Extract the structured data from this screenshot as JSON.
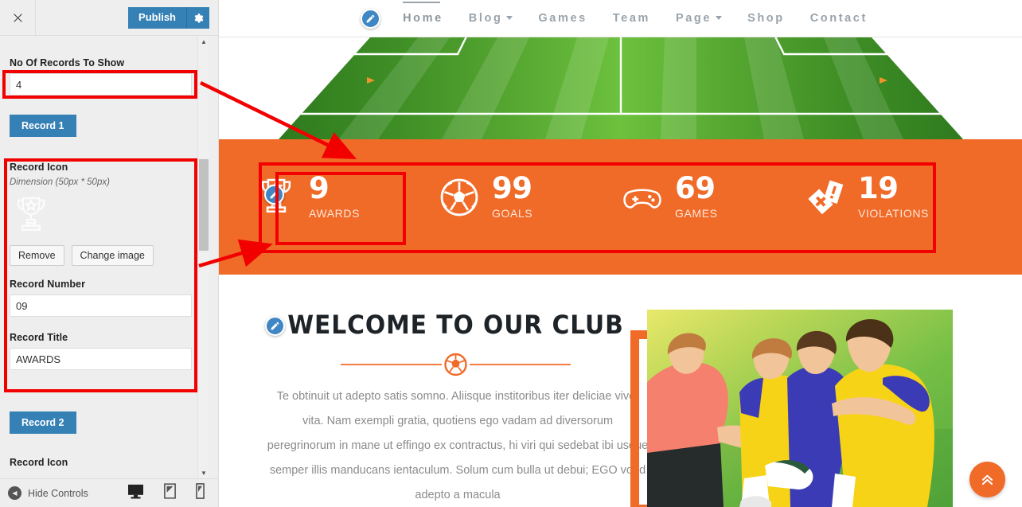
{
  "customizer": {
    "close_icon": "close-icon",
    "publish_label": "Publish",
    "gear_icon": "gear-icon",
    "records_count_label": "No Of Records To Show",
    "records_count_value": "4",
    "record1_button": "Record 1",
    "record2_button": "Record 2",
    "record_icon_label": "Record Icon",
    "record_icon_dimension": "Dimension (50px * 50px)",
    "remove_label": "Remove",
    "change_image_label": "Change image",
    "record_number_label": "Record Number",
    "record_number_value": "09",
    "record_title_label": "Record Title",
    "record_title_value": "AWARDS",
    "record2_icon_label": "Record Icon",
    "hide_controls_label": "Hide Controls",
    "device_icons": [
      "desktop-icon",
      "tablet-icon",
      "mobile-icon"
    ]
  },
  "site": {
    "nav": [
      {
        "label": "Home",
        "active": true,
        "caret": false
      },
      {
        "label": "Blog",
        "active": false,
        "caret": true
      },
      {
        "label": "Games",
        "active": false,
        "caret": false
      },
      {
        "label": "Team",
        "active": false,
        "caret": false
      },
      {
        "label": "Page",
        "active": false,
        "caret": true
      },
      {
        "label": "Shop",
        "active": false,
        "caret": false
      },
      {
        "label": "Contact",
        "active": false,
        "caret": false
      }
    ],
    "stats": [
      {
        "icon": "trophy-icon",
        "number": "9",
        "title": "AWARDS"
      },
      {
        "icon": "soccer-ball-icon",
        "number": "99",
        "title": "GOALS"
      },
      {
        "icon": "gamepad-icon",
        "number": "69",
        "title": "GAMES"
      },
      {
        "icon": "penalty-cards-icon",
        "number": "19",
        "title": "VIOLATIONS"
      }
    ],
    "welcome": {
      "title": "WELCOME TO OUR CLUB",
      "body": "Te obtinuit ut adepto satis somno. Aliisque institoribus iter deliciae vivet vita. Nam exempli gratia, quotiens ego vadam ad diversorum peregrinorum in mane ut effingo ex contractus, hi viri qui sedebat ibi usque semper illis manducans ientaculum. Solum cum bulla ut debui; EGO voud adepto a macula"
    },
    "scroll_top_icon": "chevron-double-up-icon"
  },
  "colors": {
    "accent_orange": "#F06A28",
    "publish_blue": "#3580B5",
    "pencil_blue": "#3F87C4",
    "annotation_red": "#F20000",
    "panel_bg": "#EEEEEE"
  }
}
